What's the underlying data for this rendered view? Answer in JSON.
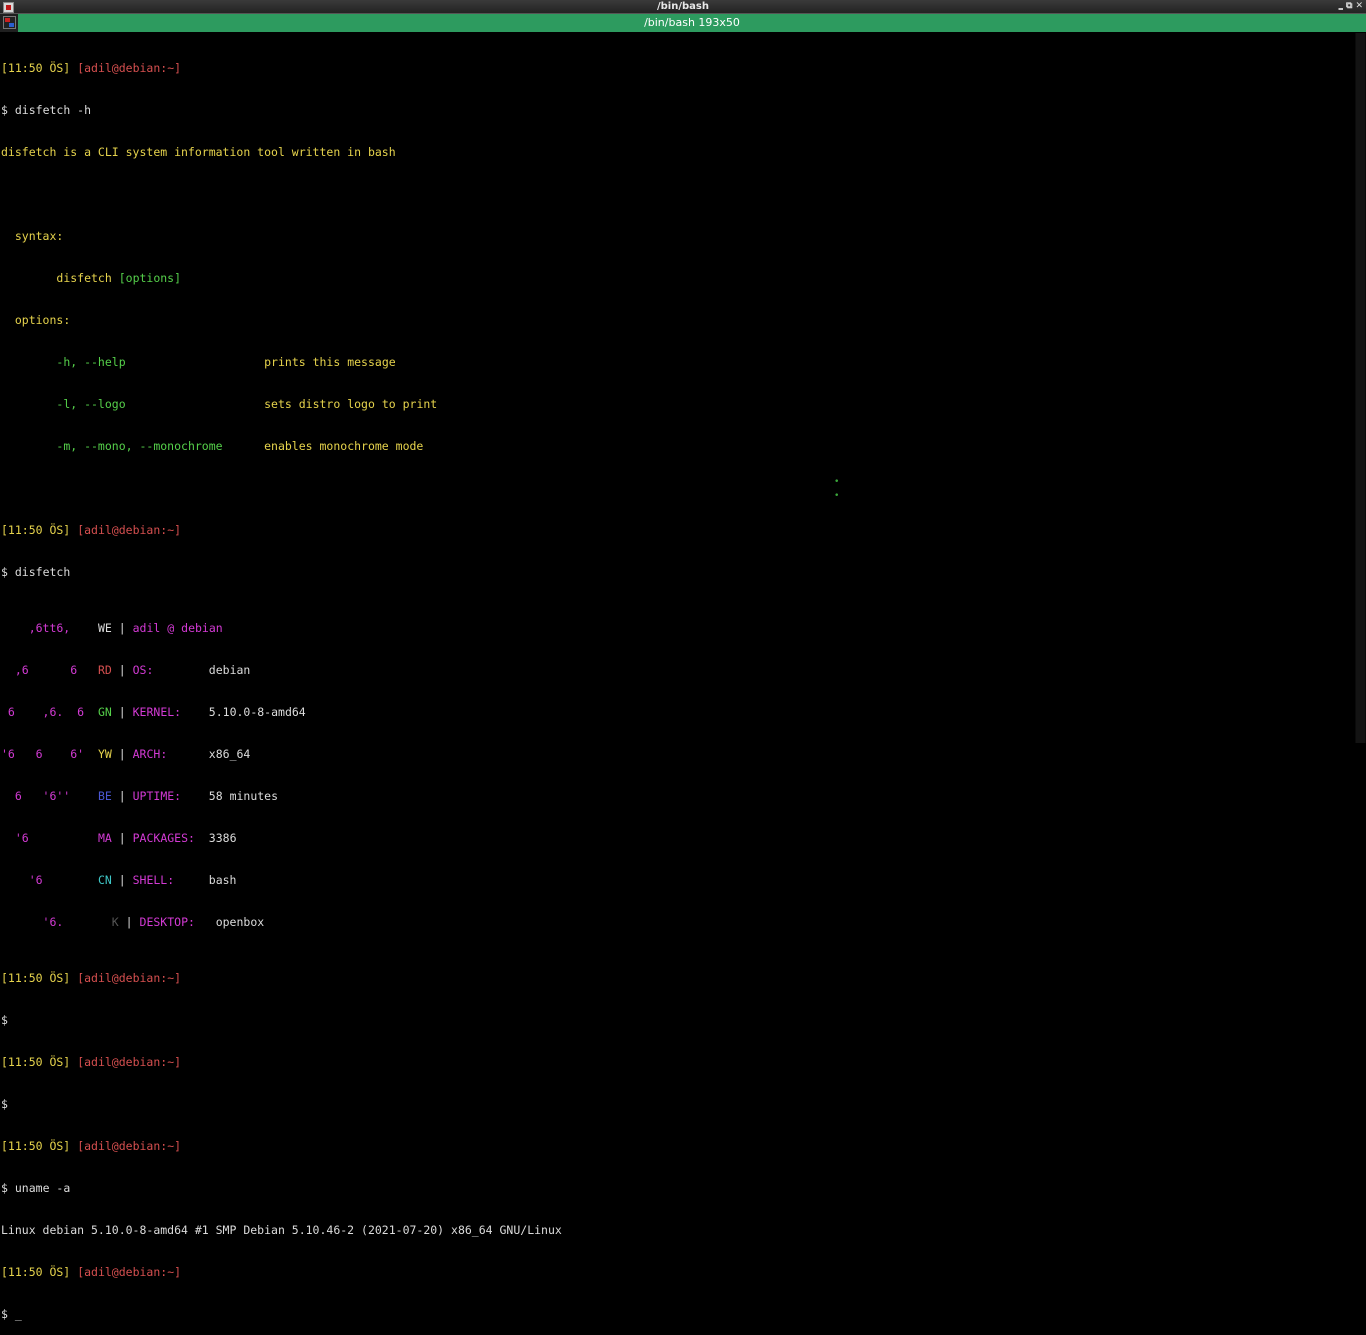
{
  "window": {
    "title": "/bin/bash",
    "tab_title": "/bin/bash 193x50",
    "controls": [
      "minimize-icon",
      "restore-icon",
      "close-icon"
    ]
  },
  "colors": {
    "prompt": "#e6d34c",
    "user": "#d54f4f",
    "options": "#55d04a",
    "labels": "#d33ad4",
    "tab": "#2d9b5f"
  },
  "prompt": {
    "time": "[11:50 ÖS]",
    "user_host": "[adil@debian:~]",
    "symbol": "$"
  },
  "commands": {
    "help": "disfetch -h",
    "fetch": "disfetch",
    "uname": "uname -a",
    "cursor": "_"
  },
  "help_output": {
    "description": "disfetch is a CLI system information tool written in bash",
    "syntax_label": "syntax:",
    "syntax_cmd": "disfetch",
    "syntax_opts": "[options]",
    "options_label": "options:",
    "options": [
      {
        "flag": "-h, --help",
        "desc": "prints this message"
      },
      {
        "flag": "-l, --logo",
        "desc": "sets distro logo to print"
      },
      {
        "flag": "-m, --mono, --monochrome",
        "desc": "enables monochrome mode"
      }
    ]
  },
  "disfetch": {
    "logo": [
      "    ,6tt6,",
      "  ,6      6",
      " 6    ,6.  6",
      "'6   6    6'",
      "  6   '6''",
      "  '6",
      "    '6",
      "      '6."
    ],
    "codes": [
      "WE",
      "RD",
      "GN",
      "YW",
      "BE",
      "MA",
      "CN",
      "K"
    ],
    "user": "adil",
    "at": "@",
    "host": "debian",
    "rows": [
      {
        "label": "OS:",
        "value": "debian"
      },
      {
        "label": "KERNEL:",
        "value": "5.10.0-8-amd64"
      },
      {
        "label": "ARCH:",
        "value": "x86_64"
      },
      {
        "label": "UPTIME:",
        "value": "58 minutes"
      },
      {
        "label": "PACKAGES:",
        "value": "3386"
      },
      {
        "label": "SHELL:",
        "value": "bash"
      },
      {
        "label": "DESKTOP:",
        "value": "openbox"
      }
    ]
  },
  "uname_output": "Linux debian 5.10.0-8-amd64 #1 SMP Debian 5.10.46-2 (2021-07-20) x86_64 GNU/Linux"
}
